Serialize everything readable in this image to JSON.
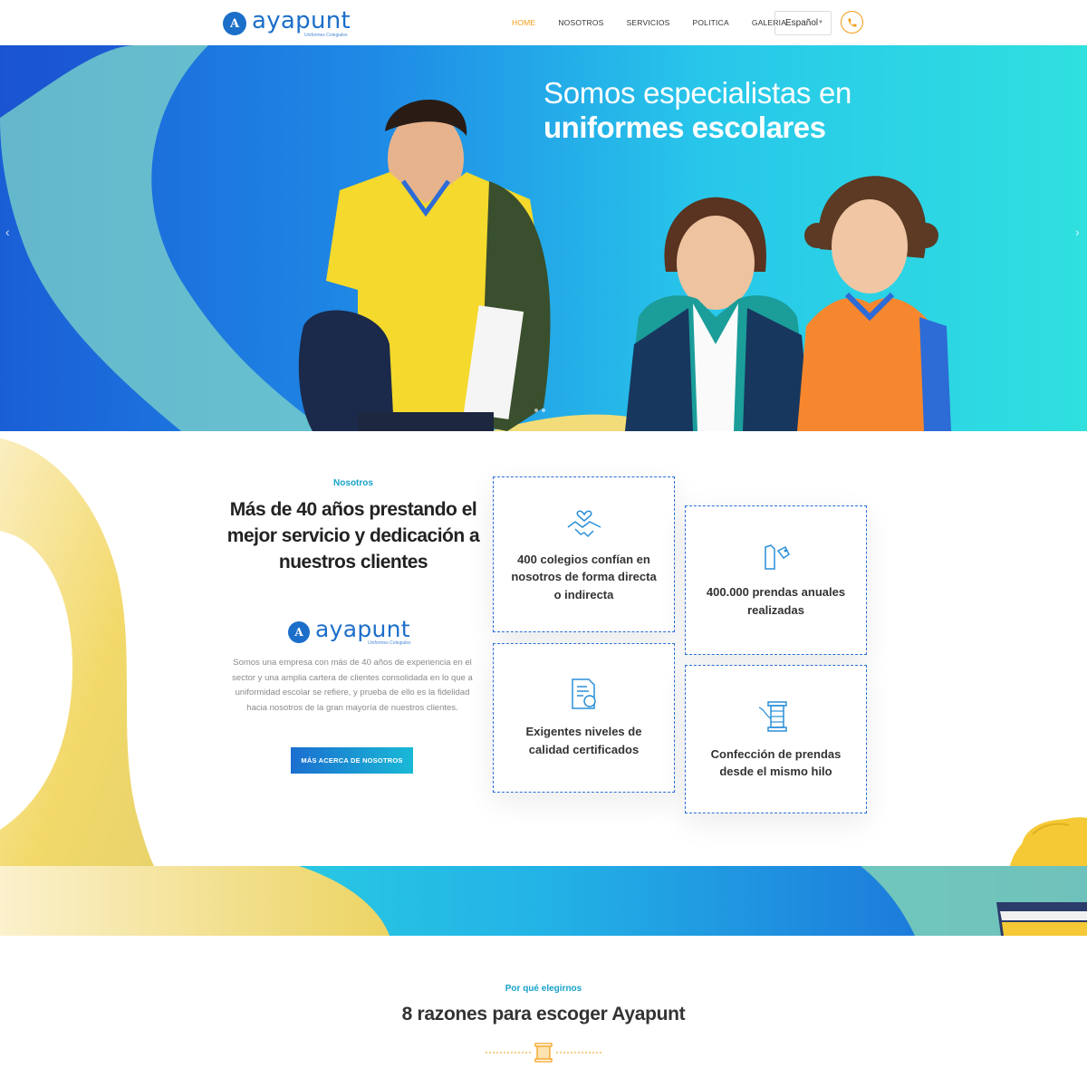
{
  "brand": {
    "name": "ayapunt",
    "tagline": "Uniformes Colegiales",
    "mark": "A",
    "colors": {
      "primary": "#1c6fc9",
      "accent": "#f39c12",
      "teal": "#17a2c8"
    }
  },
  "nav": {
    "items": [
      {
        "label": "HOME",
        "active": true
      },
      {
        "label": "NOSOTROS",
        "active": false
      },
      {
        "label": "SERVICIOS",
        "active": false
      },
      {
        "label": "POLITICA",
        "active": false
      },
      {
        "label": "GALERIA",
        "active": false
      }
    ],
    "language": "Español",
    "phone_icon": "phone-icon"
  },
  "hero": {
    "title_light": "Somos especialistas en",
    "title_bold": "uniformes escolares",
    "prev_icon": "chevron-left-icon",
    "next_icon": "chevron-right-icon",
    "slides": 2
  },
  "about": {
    "eyebrow": "Nosotros",
    "title": "Más de 40 años prestando el mejor servicio y dedicación a nuestros clientes",
    "text": "Somos una empresa con más de 40 años de experiencia en el sector y una amplia cartera de clientes consolidada en lo que a uniformidad escolar se refiere, y prueba de ello es la fidelidad hacia nosotros de la gran mayoría de nuestros clientes.",
    "button": "MÁS ACERCA DE NOSOTROS"
  },
  "cards": [
    {
      "icon": "handshake-heart-icon",
      "text": "400 colegios confían en nosotros de forma directa o indirecta"
    },
    {
      "icon": "clothes-tag-icon",
      "text": "400.000 prendas anuales realizadas"
    },
    {
      "icon": "certificate-icon",
      "text": "Exigentes niveles de calidad certificados"
    },
    {
      "icon": "thread-spool-icon",
      "text": "Confección de prendas desde el mismo hilo"
    }
  ],
  "reasons": {
    "eyebrow": "Por qué elegirnos",
    "title": "8 razones para escoger Ayapunt",
    "divider_icon": "thread-spool-icon"
  }
}
